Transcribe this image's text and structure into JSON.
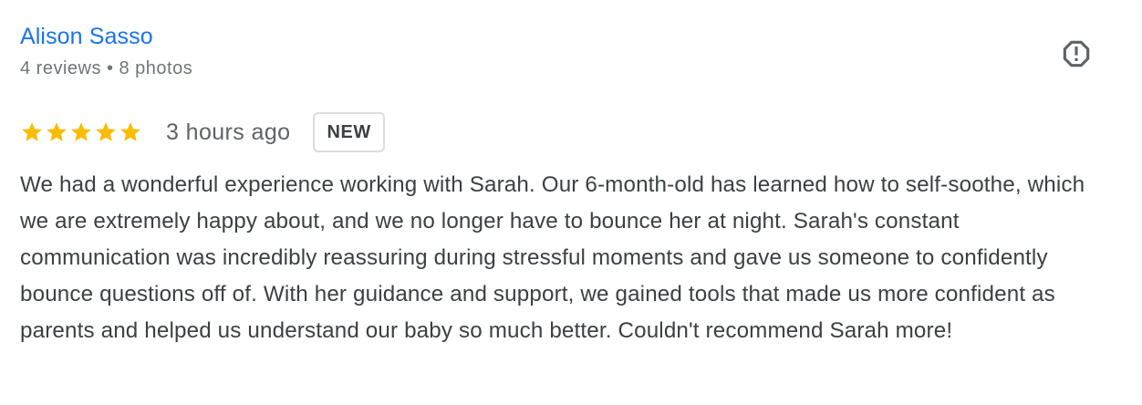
{
  "reviewer": {
    "name": "Alison Sasso",
    "reviews": "4 reviews",
    "separator": "•",
    "photos": "8 photos"
  },
  "review": {
    "rating": 5,
    "max_rating": 5,
    "timestamp": "3 hours ago",
    "badge": "NEW",
    "text": "We had a wonderful experience working with Sarah. Our 6-month-old has learned how to self-soothe, which we are extremely happy about, and we no longer have to bounce her at night. Sarah's constant communication was incredibly reassuring during stressful moments and gave us someone to confidently bounce questions off of. With her guidance and support, we gained tools that made us more confident as parents and helped us understand our baby so much better. Couldn't recommend Sarah more!"
  },
  "icons": {
    "report": "report-exclamation-icon",
    "star": "star-icon"
  },
  "colors": {
    "name_link": "#1a73e8",
    "star": "#fbbc04",
    "meta_text": "#70757a",
    "body_text": "#3c4043",
    "badge_border": "#dadce0"
  }
}
